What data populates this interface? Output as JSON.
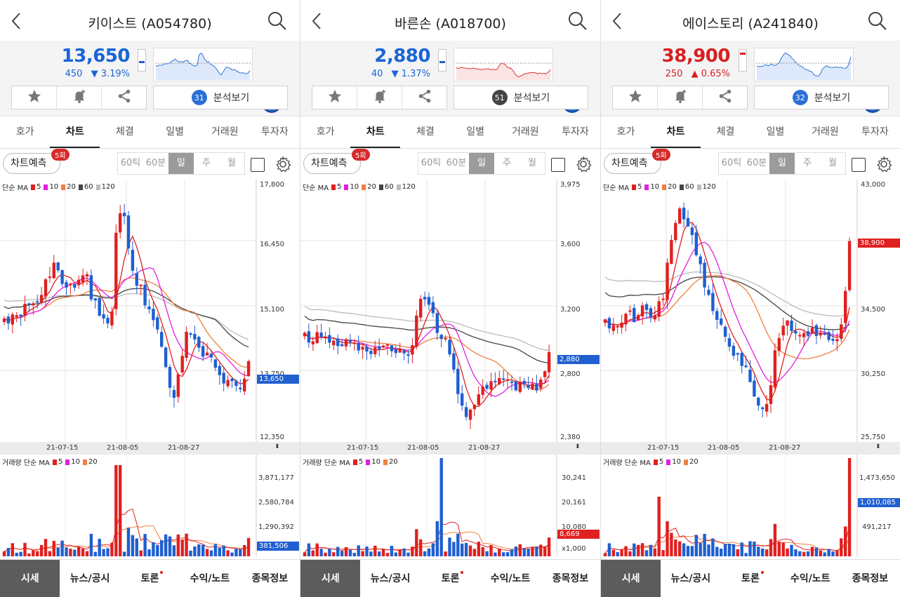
{
  "colors": {
    "up": "#e02020",
    "down": "#1f5fd0",
    "ma5": "#e02020",
    "ma10": "#e020e0",
    "ma20": "#f08040",
    "ma60": "#444444",
    "ma120": "#bbbbbb"
  },
  "common": {
    "tabs": [
      "호가",
      "차트",
      "체결",
      "일별",
      "거래원",
      "투자자"
    ],
    "active_tab": "차트",
    "predict_label": "차트예측",
    "predict_badge": "5회",
    "periods": [
      "60틱",
      "60분",
      "일",
      "주",
      "월"
    ],
    "selected_period": "일",
    "analysis_label": "분석보기",
    "ma_label": "단순 MA",
    "ma_items": [
      "5",
      "10",
      "20",
      "60",
      "120"
    ],
    "vol_label": "거래량 단순 MA",
    "vol_ma_items": [
      "5",
      "10",
      "20"
    ],
    "dates": [
      "21-07-15",
      "21-08-05",
      "21-08-27"
    ],
    "bottom_nav": [
      "시세",
      "뉴스/공시",
      "토론",
      "수익/노트",
      "종목정보"
    ],
    "icons": [
      "back-icon",
      "search-icon",
      "star-icon",
      "bell-plus-icon",
      "share-icon",
      "gear-icon"
    ]
  },
  "panels": [
    {
      "title": "키이스트 (A054780)",
      "price": "13,650",
      "change": "450",
      "rate": "▼ 3.19%",
      "direction": "down",
      "analysis_count": "31",
      "price_axis": [
        "17,800",
        "16,450",
        "15,100",
        "13,750",
        "12,350"
      ],
      "current_tag": "13,650",
      "vol_axis": [
        "3,871,177",
        "2,580,784",
        "1,290,392"
      ],
      "vol_tag": "381,506",
      "chart_data": {
        "type": "candlestick",
        "y_range": [
          12350,
          17800
        ],
        "last_close": 13650
      }
    },
    {
      "title": "바른손 (A018700)",
      "price": "2,880",
      "change": "40",
      "rate": "▼ 1.37%",
      "direction": "down",
      "analysis_count": "51",
      "price_axis": [
        "3,975",
        "3,600",
        "3,200",
        "2,800",
        "2,380"
      ],
      "current_tag": "2,880",
      "vol_axis": [
        "30,241",
        "20,161",
        "10,080",
        "x1,000"
      ],
      "vol_tag": "8,669",
      "chart_data": {
        "type": "candlestick",
        "y_range": [
          2380,
          3975
        ],
        "last_close": 2880
      }
    },
    {
      "title": "에이스토리 (A241840)",
      "price": "38,900",
      "change": "250",
      "rate": "▲ 0.65%",
      "direction": "up",
      "analysis_count": "32",
      "price_axis": [
        "43,000",
        "38,900",
        "34,500",
        "30,250",
        "25,750"
      ],
      "current_tag": "38,900",
      "vol_axis": [
        "1,473,650",
        "1,010,085",
        "491,217"
      ],
      "vol_tag": "1,010,085",
      "chart_data": {
        "type": "candlestick",
        "y_range": [
          25750,
          43000
        ],
        "last_close": 38900
      }
    }
  ]
}
